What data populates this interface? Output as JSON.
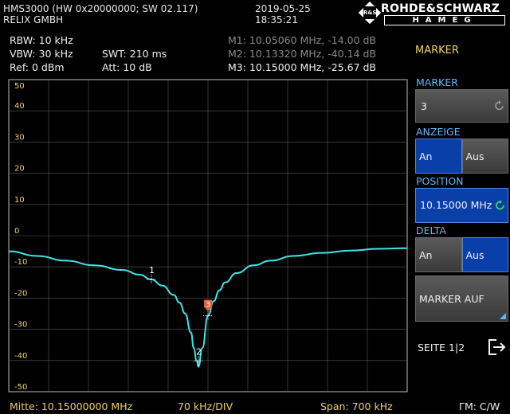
{
  "header": {
    "device": "HMS3000 (HW 0x20000000; SW 02.117)",
    "company": "RELIX GMBH",
    "date": "2019-05-25",
    "time": "18:35:21",
    "logo_top": "ROHDE&SCHWARZ",
    "logo_bottom": "HAMEG",
    "logo_emblem": "R&S"
  },
  "params": {
    "rbw": "RBW: 10 kHz",
    "vbw": "VBW: 30 kHz",
    "ref": "Ref: 0 dBm",
    "swt": "SWT: 210 ms",
    "att": "Att: 10 dB"
  },
  "markers_readout": {
    "m1": "M1: 10.05060 MHz, -14.00 dB",
    "m2": "M2: 10.13320 MHz, -40.14 dB",
    "m3": "M3: 10.15000 MHz, -25.67 dB"
  },
  "sidebar": {
    "title": "MARKER",
    "marker_label": "MARKER",
    "marker_value": "3",
    "anzeige_label": "ANZEIGE",
    "anzeige_on": "An",
    "anzeige_off": "Aus",
    "position_label": "POSITION",
    "position_value": "10.15000 MHz",
    "delta_label": "DELTA",
    "delta_on": "An",
    "delta_off": "Aus",
    "marker_auf": "MARKER AUF",
    "seite": "SEITE 1|2"
  },
  "footer": {
    "center": "Mitte: 10.15000000 MHz",
    "div": "70 kHz/DIV",
    "span": "Span: 700 kHz",
    "mode": "ΓM: C/W"
  },
  "colors": {
    "trace": "#39e6e6",
    "grid": "#5a5a5a",
    "accent_blue": "#5cb8ff",
    "accent_yellow": "#f0d060",
    "marker_active": "#e0603a"
  },
  "chart_data": {
    "type": "line",
    "title": "",
    "xlabel": "",
    "ylabel": "",
    "x_unit": "MHz",
    "y_unit": "dB",
    "xlim": [
      9.8,
      10.5
    ],
    "ylim": [
      -50,
      50
    ],
    "ytick_labels": [
      "50",
      "40",
      "30",
      "20",
      "10",
      "0",
      "-10",
      "-20",
      "-30",
      "-40",
      "-50"
    ],
    "grid": true,
    "series": [
      {
        "values_x": [
          9.8,
          9.85,
          9.9,
          9.95,
          10.0,
          10.03,
          10.05,
          10.07,
          10.09,
          10.1,
          10.11,
          10.12,
          10.125,
          10.13,
          10.1332,
          10.14,
          10.15,
          10.16,
          10.17,
          10.18,
          10.2,
          10.23,
          10.26,
          10.3,
          10.35,
          10.4,
          10.45,
          10.5
        ],
        "values_y": [
          -5,
          -6.5,
          -8,
          -9.5,
          -11,
          -12.5,
          -14,
          -16,
          -19,
          -21.5,
          -25,
          -31,
          -36,
          -40,
          -42,
          -36,
          -25.7,
          -21,
          -17.5,
          -15,
          -12,
          -9.5,
          -8,
          -6.5,
          -5.5,
          -4.8,
          -4.2,
          -4
        ]
      }
    ],
    "markers": [
      {
        "label": "1",
        "x": 10.0506,
        "y": -14.0
      },
      {
        "label": "2",
        "x": 10.1332,
        "y": -40.14
      },
      {
        "label": "3",
        "x": 10.15,
        "y": -25.67
      }
    ]
  }
}
